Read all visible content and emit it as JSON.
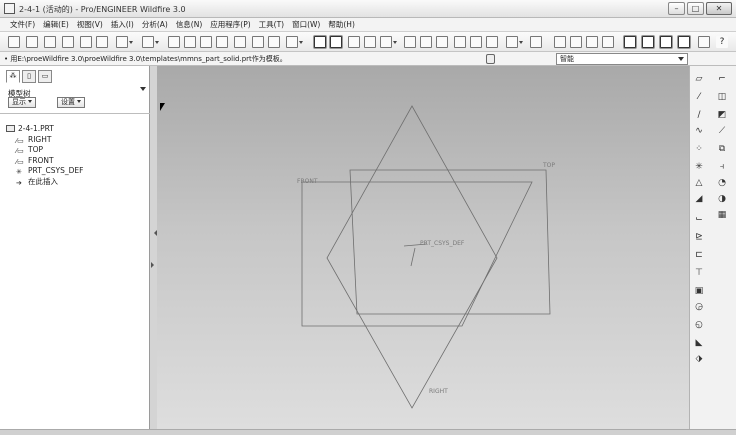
{
  "window": {
    "title": "2-4-1 (活动的) - Pro/ENGINEER Wildfire 3.0",
    "minimize": "–",
    "maximize": "□",
    "close": "✕"
  },
  "menu": [
    "文件(F)",
    "编辑(E)",
    "视图(V)",
    "插入(I)",
    "分析(A)",
    "信息(N)",
    "应用程序(P)",
    "工具(T)",
    "窗口(W)",
    "帮助(H)"
  ],
  "address": {
    "message": "• 用E:\\proeWildfire 3.0\\proeWildfire 3.0\\templates\\mmns_part_solid.prt作为模板。",
    "filter_value": "智能"
  },
  "panel": {
    "tab_icons": [
      "model-tree-tab-icon",
      "folder-tab-icon",
      "favorites-tab-icon"
    ],
    "tree_title": "模型树",
    "show_button": "显示",
    "settings_button": "设置",
    "tree": [
      {
        "label": "2-4-1.PRT",
        "icon": "part-icon",
        "level": 0
      },
      {
        "label": "RIGHT",
        "icon": "datum-plane-icon",
        "level": 1
      },
      {
        "label": "TOP",
        "icon": "datum-plane-icon",
        "level": 1
      },
      {
        "label": "FRONT",
        "icon": "datum-plane-icon",
        "level": 1
      },
      {
        "label": "PRT_CSYS_DEF",
        "icon": "csys-icon",
        "level": 1
      },
      {
        "label": "在此插入",
        "icon": "insert-here-icon",
        "level": 1
      }
    ]
  },
  "graphics": {
    "plane_labels": {
      "front": "FRONT",
      "top": "TOP",
      "right": "RIGHT"
    },
    "csys_label": "PRT_CSYS_DEF",
    "line_color": "#6e6e6e",
    "label_color": "#7a7a7a"
  },
  "toolbar_icons": [
    "new-icon",
    "open-icon",
    "save-icon",
    "print-icon",
    "email-icon",
    "undo-icon",
    "redo-icon",
    "cut-icon",
    "copy-icon",
    "paste-icon",
    "regenerate-icon",
    "find-icon",
    "select-icon",
    "refit-icon",
    "zoom-in-icon",
    "zoom-out-icon",
    "orient-icon",
    "saved-views-icon",
    "layers-icon",
    "shading-icon",
    "datum-plane-toggle-icon",
    "datum-axis-toggle-icon",
    "point-toggle-icon",
    "csys-toggle-icon",
    "help-icon"
  ],
  "right_toolbar_icons": [
    "datum-plane-tool-icon",
    "datum-axis-tool-icon",
    "sketch-tool-icon",
    "curve-tool-icon",
    "point-tool-icon",
    "csys-tool-icon",
    "analysis-tool-icon",
    "extrude-icon",
    "revolve-icon",
    "sweep-icon",
    "hole-icon",
    "shell-icon",
    "rib-icon",
    "draft-icon",
    "round-icon",
    "chamfer-icon",
    "mirror-icon",
    "pattern-icon"
  ]
}
